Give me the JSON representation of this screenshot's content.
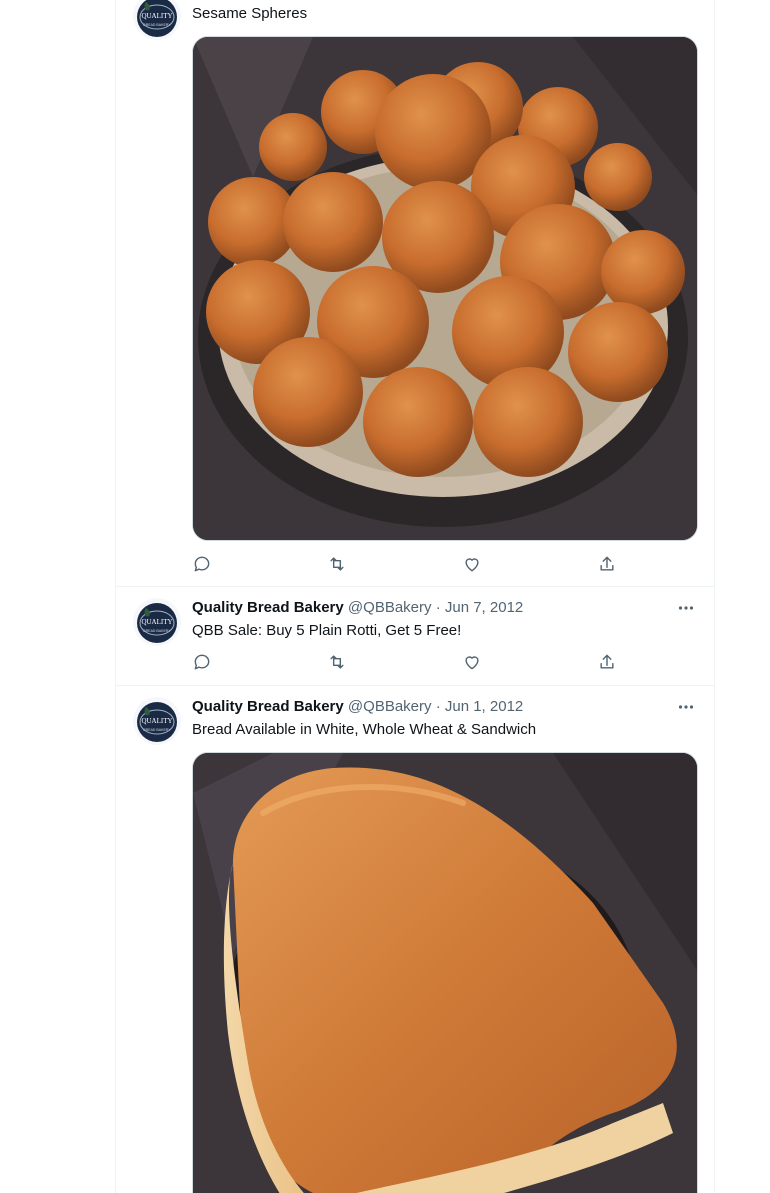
{
  "tweets": [
    {
      "text": "Sesame Spheres",
      "media": {
        "kind": "photo",
        "subject": "sesame-spheres"
      }
    },
    {
      "author": {
        "name": "Quality Bread Bakery",
        "handle": "@QBBakery"
      },
      "separator": "·",
      "date": "Jun 7, 2012",
      "text": "QBB Sale: Buy 5 Plain Rotti, Get 5 Free!"
    },
    {
      "author": {
        "name": "Quality Bread Bakery",
        "handle": "@QBBakery"
      },
      "separator": "·",
      "date": "Jun 1, 2012",
      "text": "Bread Available in White, Whole Wheat & Sandwich",
      "media": {
        "kind": "photo",
        "subject": "bread-loaf"
      }
    }
  ],
  "avatar_logo": {
    "line1": "QUALITY",
    "line2": "BREAD BAKERY"
  },
  "colors": {
    "text_primary": "#0f1419",
    "text_secondary": "#536471",
    "border": "#eff3f4",
    "avatar_bg": "#1b2a44",
    "photo_backdrop": "#3a3438"
  },
  "icons": [
    "reply-icon",
    "retweet-icon",
    "like-icon",
    "share-icon",
    "more-icon"
  ]
}
